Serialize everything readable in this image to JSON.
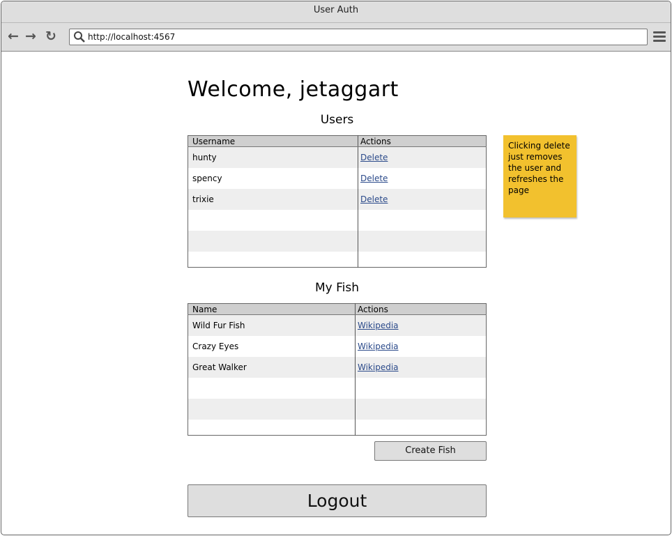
{
  "window": {
    "title": "User Auth"
  },
  "browser": {
    "url": "http://localhost:4567"
  },
  "page": {
    "heading": "Welcome, jetaggart",
    "users_title": "Users",
    "users_table": {
      "columns": [
        "Username",
        "Actions"
      ],
      "rows": [
        {
          "name": "hunty",
          "action": "Delete"
        },
        {
          "name": "spency",
          "action": "Delete"
        },
        {
          "name": "trixie",
          "action": "Delete"
        }
      ]
    },
    "fish_title": "My Fish",
    "fish_table": {
      "columns": [
        "Name",
        "Actions"
      ],
      "rows": [
        {
          "name": "Wild Fur Fish",
          "action": "Wikipedia"
        },
        {
          "name": "Crazy Eyes",
          "action": "Wikipedia"
        },
        {
          "name": "Great Walker",
          "action": "Wikipedia"
        }
      ]
    },
    "create_fish_label": "Create Fish",
    "logout_label": "Logout",
    "note": "Clicking delete just removes the user and refreshes the page"
  }
}
